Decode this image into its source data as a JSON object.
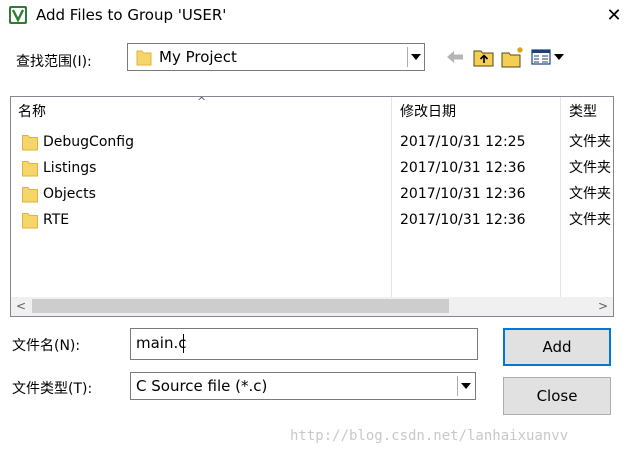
{
  "window": {
    "title": "Add Files to Group 'USER'",
    "app_icon": "keil-uvision-icon",
    "close_label": "✕"
  },
  "look_in": {
    "label": "查找范围(I):",
    "value": "My Project"
  },
  "toolbar": {
    "icons": [
      "back-arrow-icon",
      "up-folder-icon",
      "new-folder-icon",
      "view-menu-icon"
    ]
  },
  "file_list": {
    "columns": [
      "名称",
      "修改日期",
      "类型"
    ],
    "rows": [
      {
        "name": "DebugConfig",
        "modified": "2017/10/31 12:25",
        "type": "文件夹"
      },
      {
        "name": "Listings",
        "modified": "2017/10/31 12:36",
        "type": "文件夹"
      },
      {
        "name": "Objects",
        "modified": "2017/10/31 12:36",
        "type": "文件夹"
      },
      {
        "name": "RTE",
        "modified": "2017/10/31 12:36",
        "type": "文件夹"
      }
    ]
  },
  "file_name": {
    "label": "文件名(N):",
    "value": "main.c"
  },
  "file_type": {
    "label": "文件类型(T):",
    "value": "C Source file (*.c)"
  },
  "buttons": {
    "add": "Add",
    "close": "Close"
  },
  "watermark": "http://blog.csdn.net/lanhaixuanvv",
  "colors": {
    "folder": "#f6d66b",
    "folder_dark": "#e2b33a",
    "accent_border": "#0078d7",
    "button_face": "#e1e1e1"
  }
}
